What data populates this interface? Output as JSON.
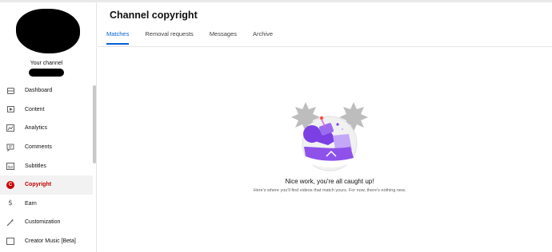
{
  "sidebar": {
    "channel_label": "Your channel",
    "items": [
      {
        "label": "Dashboard",
        "icon": "dashboard-icon"
      },
      {
        "label": "Content",
        "icon": "content-icon"
      },
      {
        "label": "Analytics",
        "icon": "analytics-icon"
      },
      {
        "label": "Comments",
        "icon": "comments-icon"
      },
      {
        "label": "Subtitles",
        "icon": "subtitles-icon"
      },
      {
        "label": "Copyright",
        "icon": "copyright-icon",
        "active": true,
        "icon_letter": "C"
      },
      {
        "label": "Earn",
        "icon": "dollar-icon"
      },
      {
        "label": "Customization",
        "icon": "magic-wand-icon"
      },
      {
        "label": "Creator Music [Beta]",
        "icon": "music-icon"
      }
    ]
  },
  "header": {
    "title": "Channel copyright"
  },
  "tabs": [
    {
      "label": "Matches",
      "active": true
    },
    {
      "label": "Removal requests"
    },
    {
      "label": "Messages"
    },
    {
      "label": "Archive"
    }
  ],
  "empty_state": {
    "title": "Nice work, you're all caught up!",
    "subtitle": "Here's where you'll find videos that match yours. For now, there's nothing new."
  },
  "colors": {
    "accent_blue": "#065fd4",
    "copyright_red": "#cc0000",
    "illustration_purple": "#7b3fe4"
  }
}
